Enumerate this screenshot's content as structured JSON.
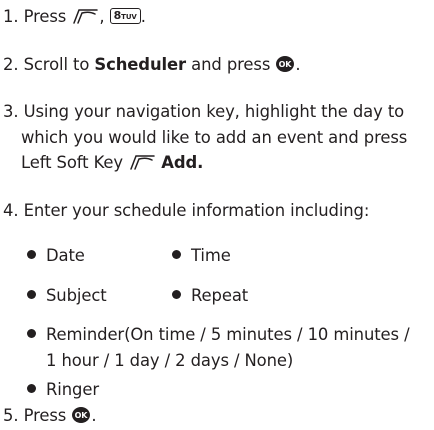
{
  "steps": [
    {
      "number": "1.",
      "text_a": "Press",
      "text_b": ",",
      "key_8": "8",
      "key_8_letters": "TUV",
      "text_c": ".",
      "icons": [
        "left-soft-key-icon",
        "key-8-icon"
      ]
    },
    {
      "number": "2.",
      "text_a": "Scroll to",
      "bold": "Scheduler",
      "text_b": "and press",
      "text_c": ".",
      "icons": [
        "ok-key-icon"
      ]
    },
    {
      "number": "3.",
      "line1": "Using your navigation key, highlight the day to",
      "line2": "which you would like to add an event and press",
      "line3_a": "Left Soft Key",
      "line3_bold": "Add.",
      "icons": [
        "left-soft-key-icon"
      ]
    },
    {
      "number": "4.",
      "text": "Enter your schedule information including:",
      "bullets": {
        "date": "Date",
        "time": "Time",
        "subject": "Subject",
        "repeat": "Repeat",
        "reminder_line1": "Reminder(On time / 5 minutes / 10 minutes /",
        "reminder_line2": "1 hour / 1 day / 2 days / None)",
        "ringer": "Ringer"
      }
    },
    {
      "number": "5.",
      "text_a": "Press",
      "text_c": ".",
      "icons": [
        "ok-key-icon"
      ]
    }
  ],
  "colors": {
    "text": "#231f20",
    "background": "#ffffff"
  }
}
